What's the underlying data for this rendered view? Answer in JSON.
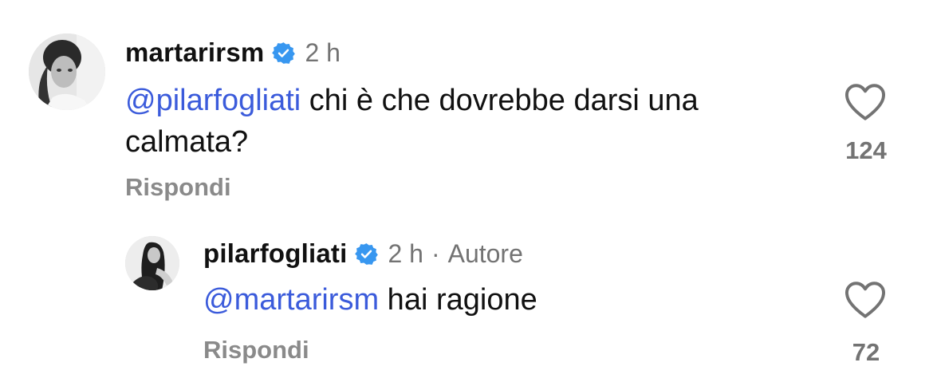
{
  "comments": [
    {
      "username": "martarirsm",
      "time": "2 h",
      "mention": "@pilarfogliati",
      "text_line1": " chi è che dovrebbe darsi una",
      "text_line2": "calmata?",
      "reply_label": "Rispondi",
      "like_count": "124"
    },
    {
      "username": "pilarfogliati",
      "time": "2 h",
      "separator": "·",
      "author_label": "Autore",
      "mention": "@martarirsm",
      "text_line1": " hai ragione",
      "reply_label": "Rispondi",
      "like_count": "72"
    }
  ],
  "colors": {
    "mention": "#3b5bdb",
    "verified_badge": "#3897f0",
    "secondary_text": "#737373"
  },
  "icons": [
    "verified-badge-icon",
    "heart-outline-icon"
  ]
}
